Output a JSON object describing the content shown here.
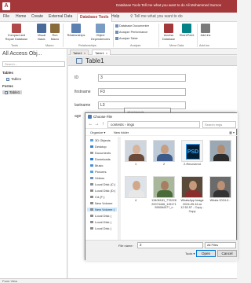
{
  "titlebar": {
    "text": "Database Tools    Tell me what you want to do    Ali Mohammed Sumon"
  },
  "menu": {
    "items": [
      "File",
      "Home",
      "Create",
      "External Data",
      "Database Tools",
      "Help"
    ],
    "active": "Database Tools",
    "tell_me": "Tell me what you want to do"
  },
  "ribbon": {
    "compact": "Compact and Repair Database",
    "visual_basic": "Visual Basic",
    "run_macro": "Run Macro",
    "relationships": "Relationships",
    "object_dependencies": "Object Dependencies",
    "database_documenter": "Database Documenter",
    "analyze_performance": "Analyze Performance",
    "analyze_table": "Analyze Table",
    "access_database": "Access Database",
    "sharepoint": "SharePoint",
    "add_ins": "Add-ins",
    "groups": {
      "tools": "Tools",
      "macro": "Macro",
      "relationships": "Relationships",
      "analyze": "Analyze",
      "move_data": "Move Data",
      "add_ins": "Add-ins"
    }
  },
  "nav": {
    "title": "All Access Obj...",
    "search_placeholder": "Search...",
    "groups": [
      {
        "label": "Tables",
        "items": [
          "Table1"
        ]
      },
      {
        "label": "Forms",
        "items": [
          "Table1"
        ]
      }
    ]
  },
  "doc": {
    "tabs": [
      "Table1",
      "Table1"
    ],
    "form_title": "Table1",
    "fields": [
      {
        "label": "ID",
        "value": "3"
      },
      {
        "label": "firstname",
        "value": "F3"
      },
      {
        "label": "lastname",
        "value": "L3"
      },
      {
        "label": "age",
        "value": ""
      }
    ]
  },
  "bgwin": {
    "text": "attachments"
  },
  "dialog": {
    "title": "Choose File",
    "address": "contests › imgs",
    "search_placeholder": "Search imgs",
    "organize": "Organize ▾",
    "new_folder": "New folder",
    "side_items": [
      "3D Objects",
      "Desktop",
      "Documents",
      "Downloads",
      "Music",
      "Pictures",
      "Videos",
      "Local Disk (C:)",
      "Local Disk (D:)",
      "Cd (F:)",
      "New Volume",
      "New Volume (",
      "Local Disk (",
      "Local Disk (",
      "Local Disk ("
    ],
    "files": [
      {
        "name": "1",
        "kind": "photo",
        "skin": "#d8b49a",
        "shirt": "#6b4a3a"
      },
      {
        "name": "2",
        "kind": "photo",
        "skin": "#c99d7f",
        "shirt": "#3c5a8a"
      },
      {
        "name": "2-Recovered",
        "kind": "psd",
        "label": "PSD"
      },
      {
        "name": "",
        "kind": "photo",
        "skin": "#b38b70",
        "shirt": "#2b2b2b"
      },
      {
        "name": "4",
        "kind": "photo",
        "skin": "#d1a88a",
        "shirt": "#e8e8e8"
      },
      {
        "name": "13406181_77622820074446_11517155506437?_n",
        "kind": "photo",
        "skin": "#a87e62",
        "shirt": "#4a6b3a"
      },
      {
        "name": "WhatsApp Image 2024-05-16 at 12.52.57 - Copy - Copy",
        "kind": "photo",
        "skin": "#c49a7a",
        "shirt": "#8a2d2d"
      },
      {
        "name": "Whats 2024-0...",
        "kind": "photo",
        "skin": "#bb9074",
        "shirt": "#333"
      }
    ],
    "filename_label": "File name:",
    "filename_value": "2",
    "filter": "All Files",
    "tools": "Tools ▾",
    "open": "Open",
    "cancel": "Cancel"
  },
  "status": {
    "text": "Form View"
  }
}
